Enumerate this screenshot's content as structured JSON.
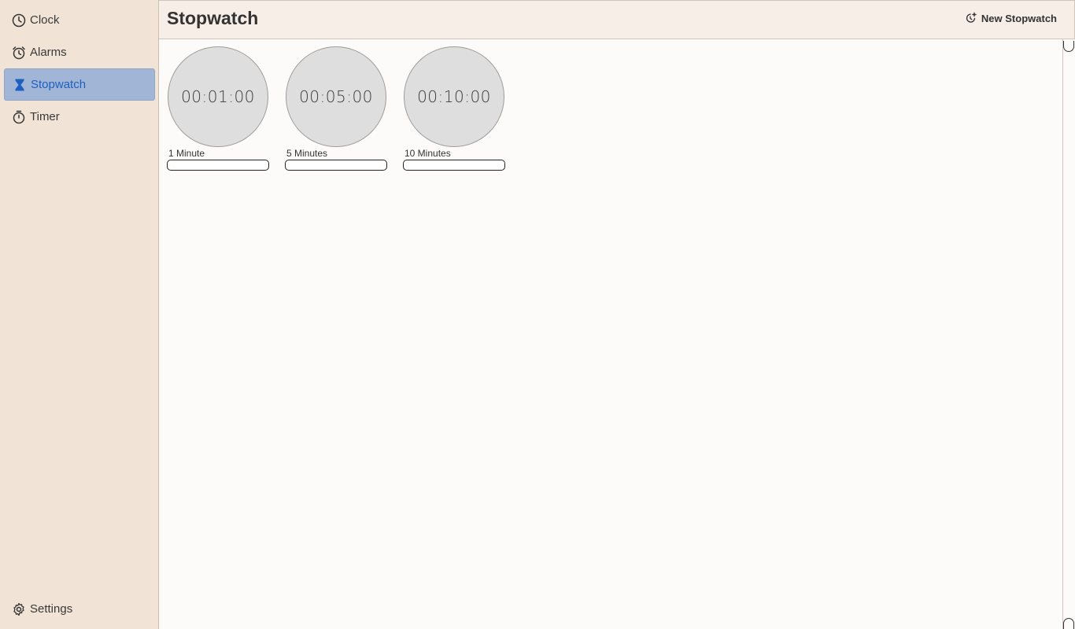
{
  "sidebar": {
    "items": [
      {
        "label": "Clock",
        "icon": "clock-icon"
      },
      {
        "label": "Alarms",
        "icon": "alarm-icon"
      },
      {
        "label": "Stopwatch",
        "icon": "hourglass-icon",
        "active": true
      },
      {
        "label": "Timer",
        "icon": "timer-icon"
      }
    ],
    "settings": {
      "label": "Settings",
      "icon": "gear-icon"
    }
  },
  "header": {
    "title": "Stopwatch",
    "new_button": {
      "label": "New Stopwatch",
      "icon": "add-timer-icon"
    }
  },
  "stopwatches": [
    {
      "time": "00:01:00",
      "label": "1 Minute"
    },
    {
      "time": "00:05:00",
      "label": "5 Minutes"
    },
    {
      "time": "00:10:00",
      "label": "10 Minutes"
    }
  ],
  "colors": {
    "sidebar_bg": "#f1e4d6",
    "active_bg": "#a1b6d6",
    "active_text": "#1e5fbf",
    "header_bg": "#f7eee8",
    "dial_bg": "#dedede"
  }
}
